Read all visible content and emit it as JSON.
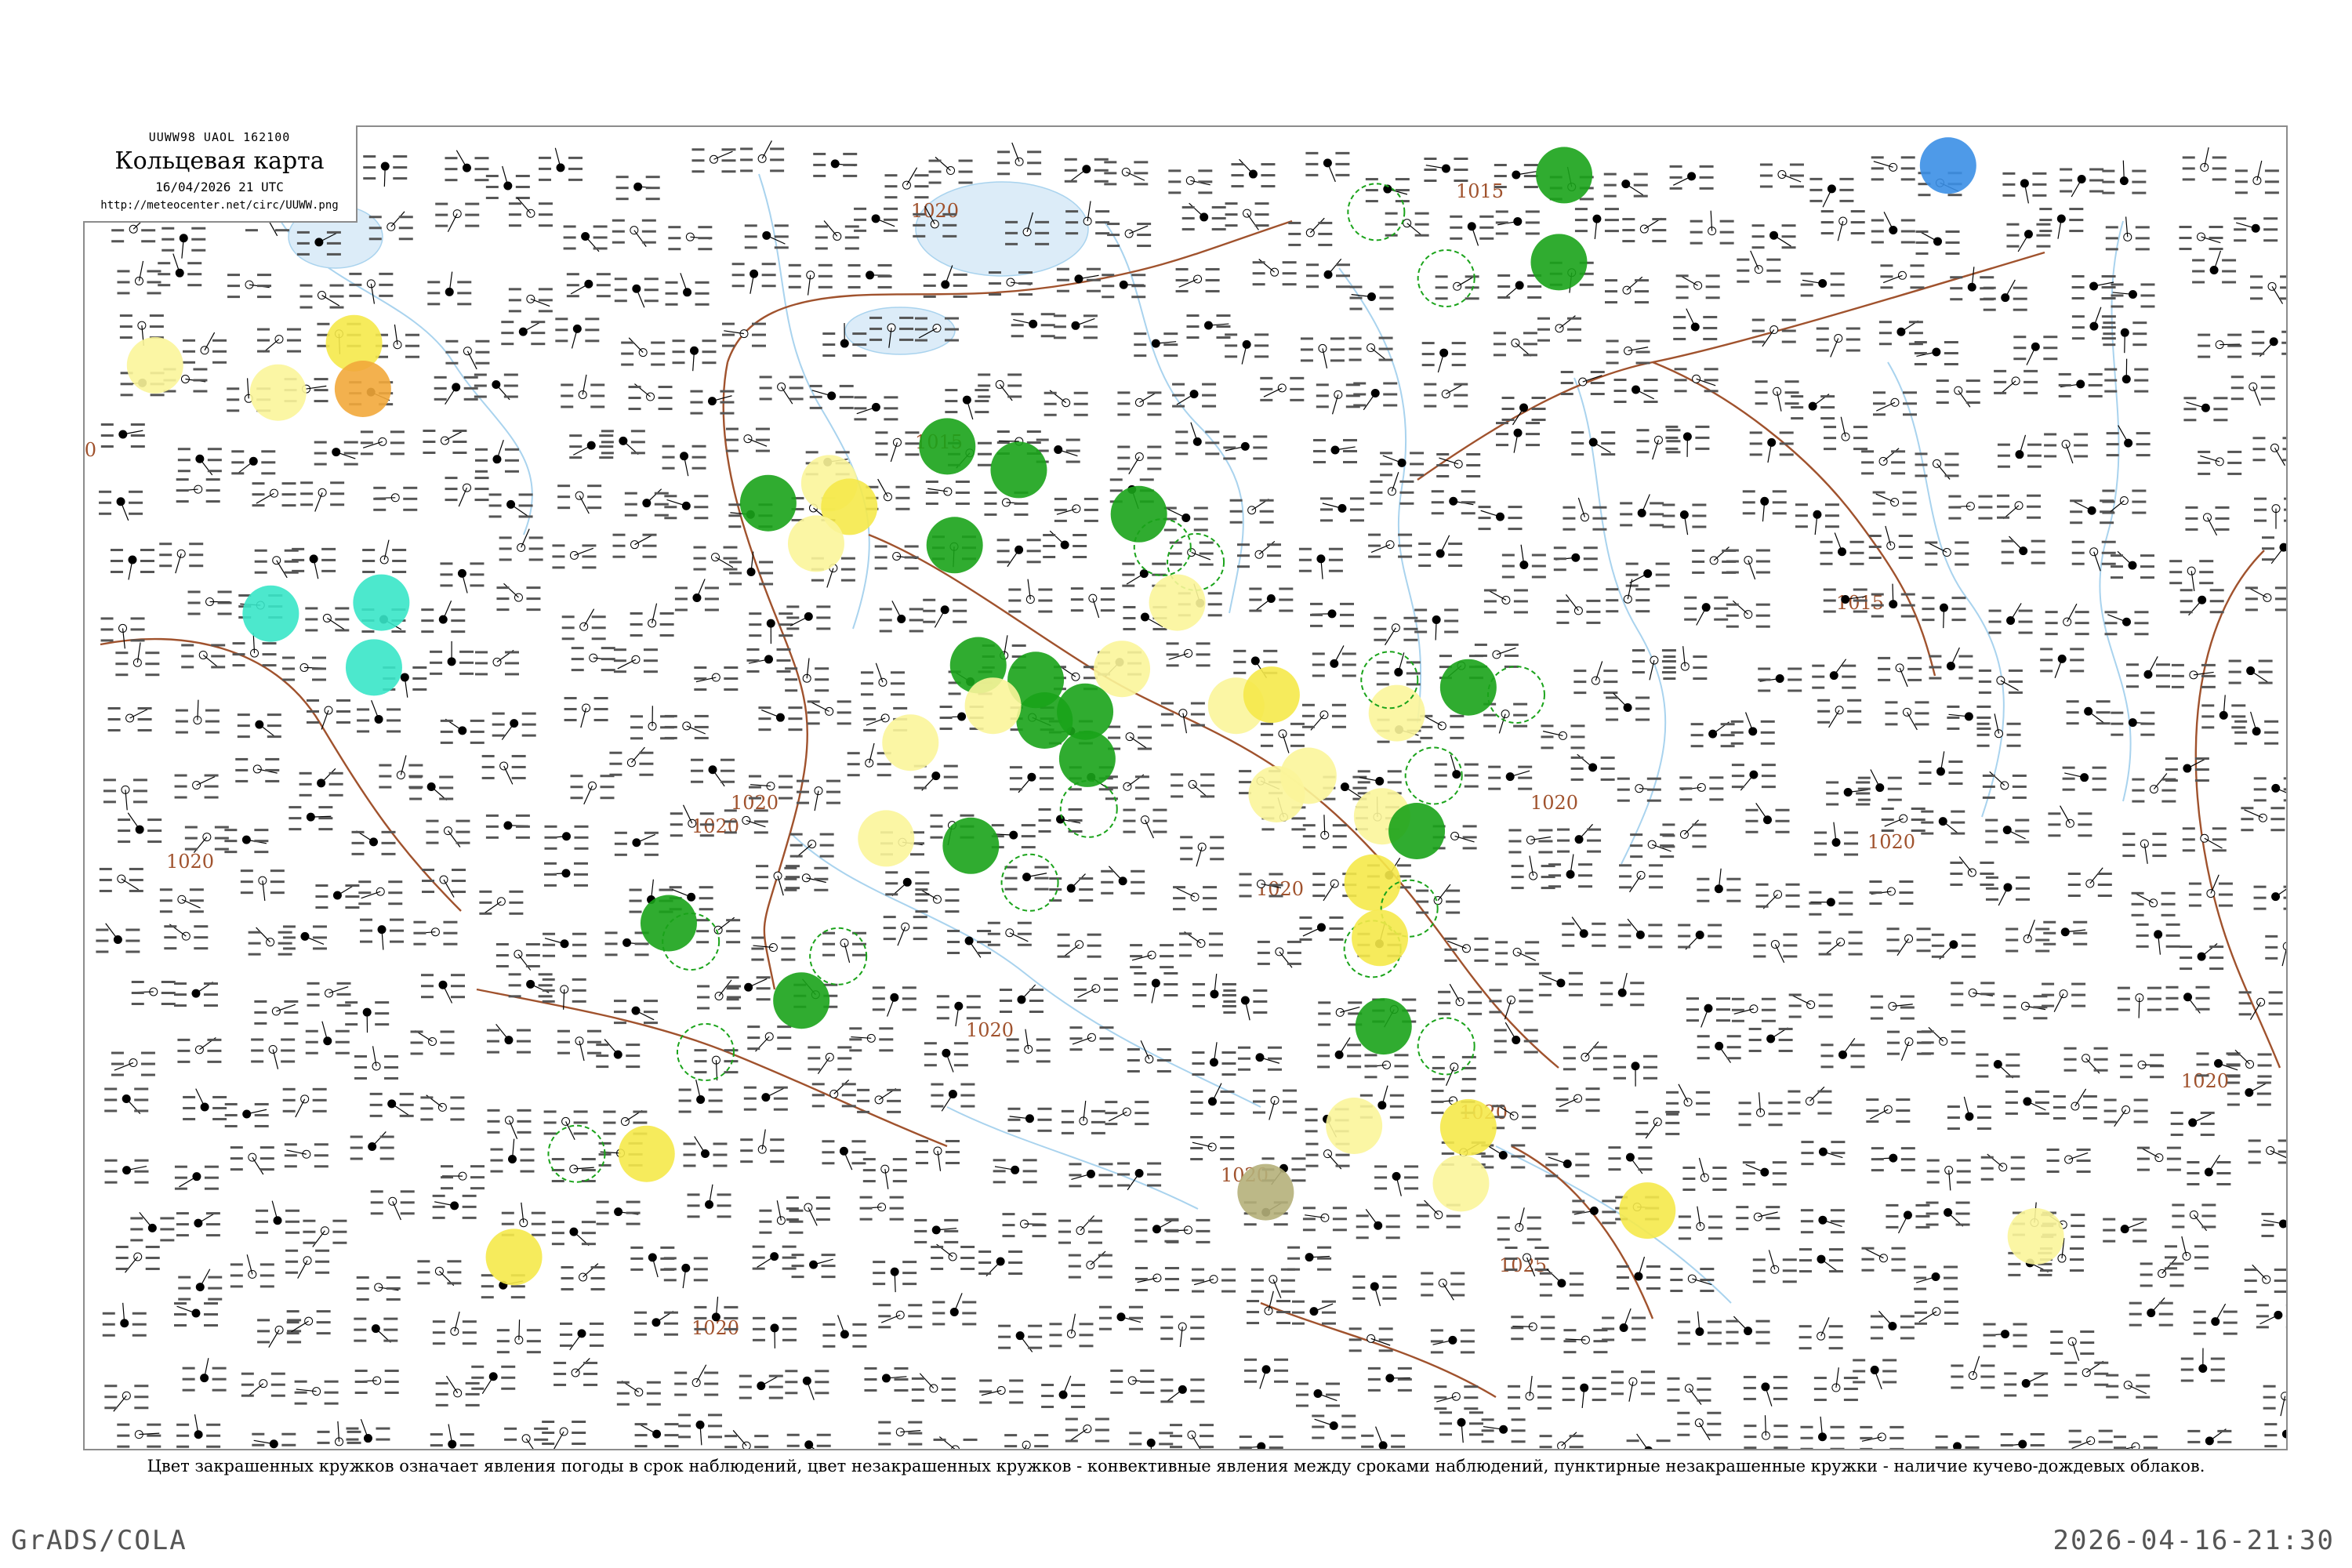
{
  "header": {
    "code": "UUWW98 UAOL 162100",
    "title": "Кольцевая карта",
    "date": "16/04/2026 21 UTC",
    "url": "http://meteocenter.net/circ/UUWW.png"
  },
  "map": {
    "isobar_labels": [
      "1020",
      "1020",
      "1015",
      "1015",
      "1020",
      "1020",
      "1020",
      "1020",
      "1020",
      "1020",
      "1015",
      "1020",
      "1020",
      "1020",
      "1025",
      "1020",
      "1020"
    ],
    "colors": {
      "precip_green": "#1aa31a",
      "yellow": "#f5e94a",
      "pale_yellow": "#fbf59a",
      "orange": "#f2a93b",
      "cyan": "#38e6c8",
      "blue": "#3b8fe6",
      "olive": "#b5b07a",
      "isobar": "#a0522d",
      "river": "#a9d3ee"
    }
  },
  "legend_note": "Цвет закрашенных кружков означает явления погоды в срок наблюдений, цвет незакрашенных кружков - конвективные явления между сроками наблюдений, пунктирные незакрашенные кружки - наличие кучево-дождевых облаков.",
  "footer": {
    "left": "GrADS/COLA",
    "right": "2026-04-16-21:30"
  }
}
